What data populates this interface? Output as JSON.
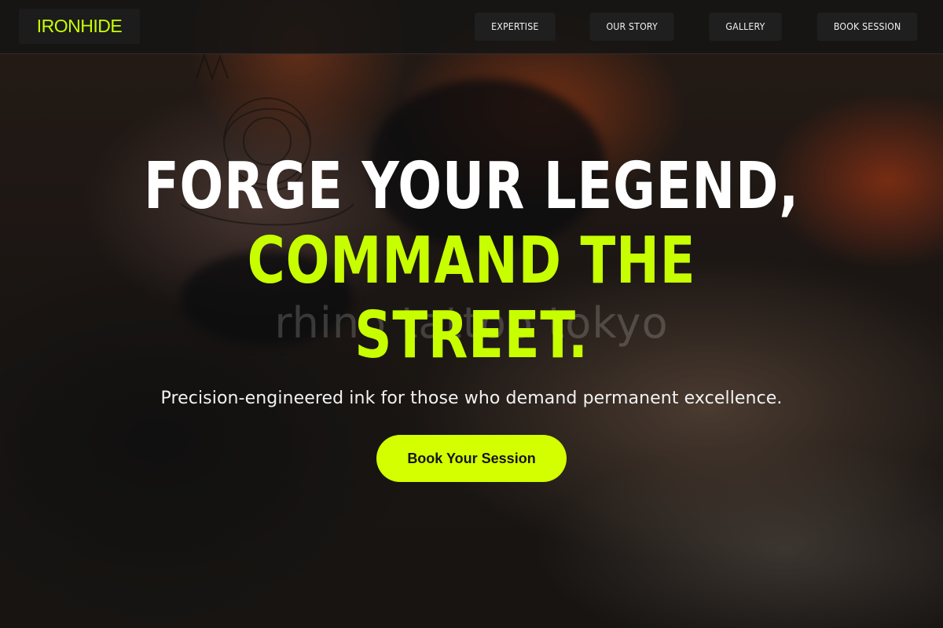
{
  "brand": {
    "logo_text": "IRONHIDE"
  },
  "nav": {
    "items": [
      {
        "label": "EXPERTISE"
      },
      {
        "label": "OUR STORY"
      },
      {
        "label": "GALLERY"
      },
      {
        "label": "BOOK SESSION"
      }
    ]
  },
  "hero": {
    "headline_line1": "FORGE YOUR LEGEND,",
    "headline_line2": "COMMAND THE",
    "headline_line3": "STREET.",
    "tagline": "Precision-engineered ink for those who demand permanent excellence.",
    "cta_label": "Book Your Session",
    "watermark": "rhino tattoo tokyo"
  },
  "colors": {
    "accent": "#c8ff00",
    "cta_background": "#d4ff00",
    "nav_background": "#1f1f1f",
    "headline_white": "#ffffff"
  }
}
